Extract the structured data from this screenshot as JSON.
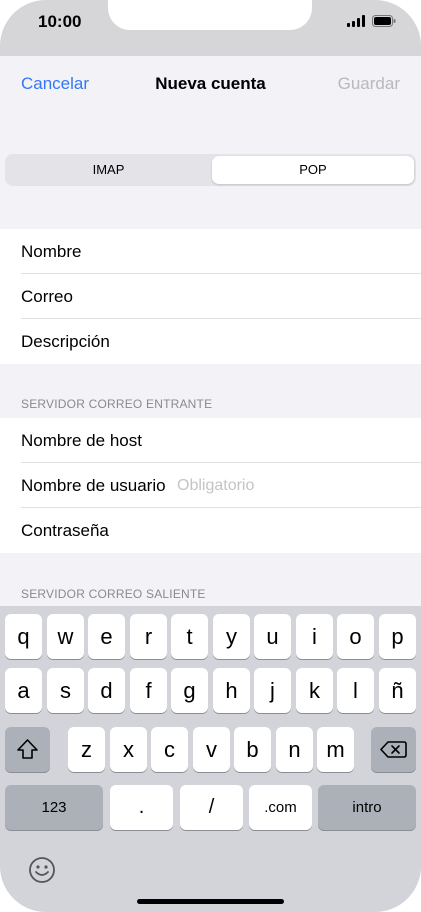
{
  "status_bar": {
    "time": "10:00"
  },
  "nav": {
    "cancel_label": "Cancelar",
    "title": "Nueva cuenta",
    "save_label": "Guardar"
  },
  "segmented": {
    "imap": "IMAP",
    "pop": "POP",
    "selected": "POP"
  },
  "account_fields": {
    "name": "Nombre",
    "email": "Correo",
    "description": "Descripción"
  },
  "incoming": {
    "header": "SERVIDOR CORREO ENTRANTE",
    "host": "Nombre de host",
    "username": "Nombre de usuario",
    "username_placeholder": "Obligatorio",
    "password": "Contraseña"
  },
  "outgoing": {
    "header": "SERVIDOR CORREO SALIENTE"
  },
  "keyboard": {
    "row1": [
      "q",
      "w",
      "e",
      "r",
      "t",
      "y",
      "u",
      "i",
      "o",
      "p"
    ],
    "row2": [
      "a",
      "s",
      "d",
      "f",
      "g",
      "h",
      "j",
      "k",
      "l",
      "ñ"
    ],
    "row3": [
      "z",
      "x",
      "c",
      "v",
      "b",
      "n",
      "m"
    ],
    "numbers": "123",
    "period": ".",
    "slash": "/",
    "dotcom": ".com",
    "return": "intro"
  }
}
